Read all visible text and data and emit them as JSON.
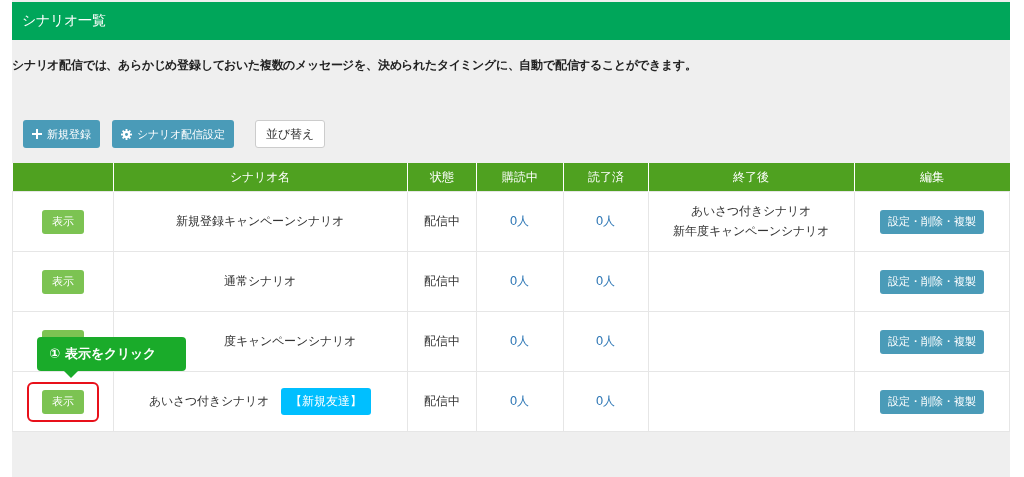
{
  "header": {
    "title": "シナリオ一覧"
  },
  "description": "シナリオ配信では、あらかじめ登録しておいた複数のメッセージを、決められたタイミングに、自動で配信することができます。",
  "toolbar": [
    {
      "kind": "add",
      "label": "新規登録"
    },
    {
      "kind": "settings",
      "label": "シナリオ配信設定"
    },
    {
      "kind": "plain",
      "label": "並び替え"
    }
  ],
  "table": {
    "columns": [
      "",
      "シナリオ名",
      "状態",
      "購読中",
      "読了済",
      "終了後",
      "編集"
    ],
    "rows": [
      {
        "show_button": "表示",
        "name": "新規登録キャンペーンシナリオ",
        "status": "配信中",
        "subscribing": "0人",
        "read": "0人",
        "after_end": [
          "あいさつ付きシナリオ",
          "新年度キャンペーンシナリオ"
        ],
        "edit_button": "設定・削除・複製"
      },
      {
        "show_button": "表示",
        "name": "通常シナリオ",
        "status": "配信中",
        "subscribing": "0人",
        "read": "0人",
        "edit_button": "設定・削除・複製"
      },
      {
        "name": "度キャンペーンシナリオ",
        "status": "配信中",
        "subscribing": "0人",
        "read": "0人",
        "edit_button": "設定・削除・複製"
      },
      {
        "show_button": "表示",
        "name": "あいさつ付きシナリオ",
        "tag": "【新規友達】",
        "status": "配信中",
        "subscribing": "0人",
        "read": "0人",
        "edit_button": "設定・削除・複製",
        "highlighted": true
      }
    ]
  },
  "callout": {
    "text": "① 表示をクリック"
  }
}
